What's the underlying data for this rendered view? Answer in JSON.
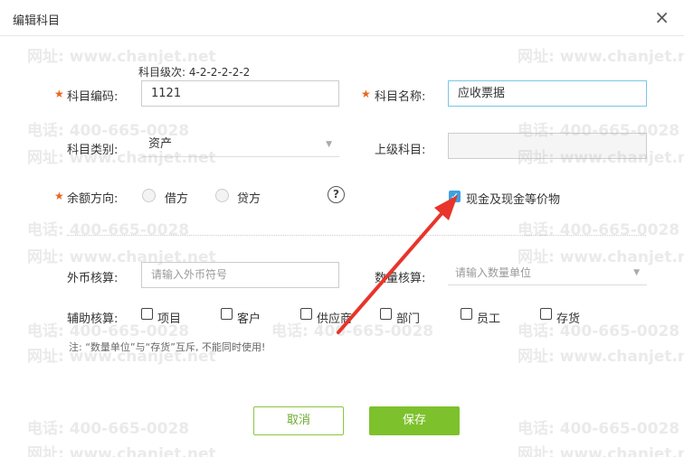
{
  "dialog": {
    "title": "编辑科目",
    "close_glyph": "×"
  },
  "form": {
    "level_hint": "科目级次: 4-2-2-2-2-2",
    "required_mark": "★",
    "code_label": "科目编码:",
    "code_value": "1121",
    "name_label": "科目名称:",
    "name_value": "应收票据",
    "category_label": "科目类别:",
    "category_value": "资产",
    "parent_label": "上级科目:",
    "parent_value": "",
    "balance_label": "余额方向:",
    "debit_label": "借方",
    "credit_label": "贷方",
    "help_glyph": "?",
    "cash_label": "现金及现金等价物",
    "cash_checked": true,
    "currency_label": "外币核算:",
    "currency_placeholder": "请输入外币符号",
    "qty_label": "数量核算:",
    "qty_placeholder": "请输入数量单位",
    "aux_label": "辅助核算:",
    "aux_items": [
      "项目",
      "客户",
      "供应商",
      "部门",
      "员工",
      "存货"
    ],
    "note": "注: “数量单位”与“存货”互斥, 不能同时使用!"
  },
  "buttons": {
    "cancel": "取消",
    "save": "保存"
  },
  "watermark": {
    "phone": "电话: 400-665-0028",
    "site": "网址: www.chanjet.net"
  },
  "colors": {
    "accent_green": "#7dc12c",
    "check_blue": "#3fa1e0",
    "required_orange": "#e8661f",
    "arrow_red": "#e8342a"
  }
}
